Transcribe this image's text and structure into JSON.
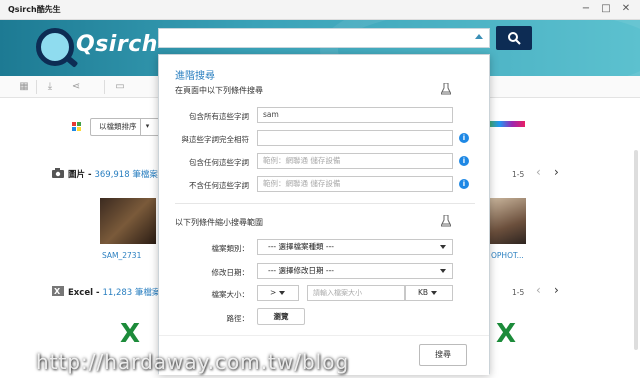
{
  "window": {
    "title": "Qsirch酷先生",
    "minimize": "−",
    "maximize": "□",
    "close": "✕"
  },
  "header": {
    "logo_text": "Qsirch",
    "search_value": ""
  },
  "toolbar": {
    "icons": [
      "grid-icon",
      "download-icon",
      "share-icon",
      "folder-icon"
    ]
  },
  "sort": {
    "label": "以檔類排序",
    "dropdown": "▾"
  },
  "sections": [
    {
      "name": "圖片",
      "count": "369,918 筆檔案",
      "pager": "1-5",
      "thumb_labels": [
        "SAM_2731",
        "OPHOT..."
      ]
    },
    {
      "name": "Excel",
      "count": "11,283 筆檔案",
      "pager": "1-5",
      "thumb_labels": [
        "X",
        "X"
      ]
    }
  ],
  "panel": {
    "title": "進階搜尋",
    "section1": "在頁面中以下列條件搜尋",
    "fields": [
      {
        "label": "包含所有這些字詞",
        "value": "sam",
        "placeholder": ""
      },
      {
        "label": "與這些字詞完全相符",
        "value": "",
        "placeholder": ""
      },
      {
        "label": "包含任何這些字詞",
        "value": "",
        "placeholder": "範例：網聯通 儲存設備"
      },
      {
        "label": "不含任何這些字詞",
        "value": "",
        "placeholder": "範例：網聯通 儲存設備"
      }
    ],
    "section2": "以下列條件縮小搜尋範圍",
    "file_type": {
      "label": "檔案類別：",
      "value": "--- 選擇檔案種類 ---"
    },
    "mod_date": {
      "label": "修改日期：",
      "value": "--- 選擇修改日期 ---"
    },
    "file_size": {
      "label": "檔案大小：",
      "op": ">",
      "placeholder": "請輸入檔案大小",
      "unit": "KB"
    },
    "path": {
      "label": "路徑：",
      "browse": "瀏覽"
    },
    "submit": "搜尋"
  },
  "watermark": "http://hardaway.com.tw/blog"
}
